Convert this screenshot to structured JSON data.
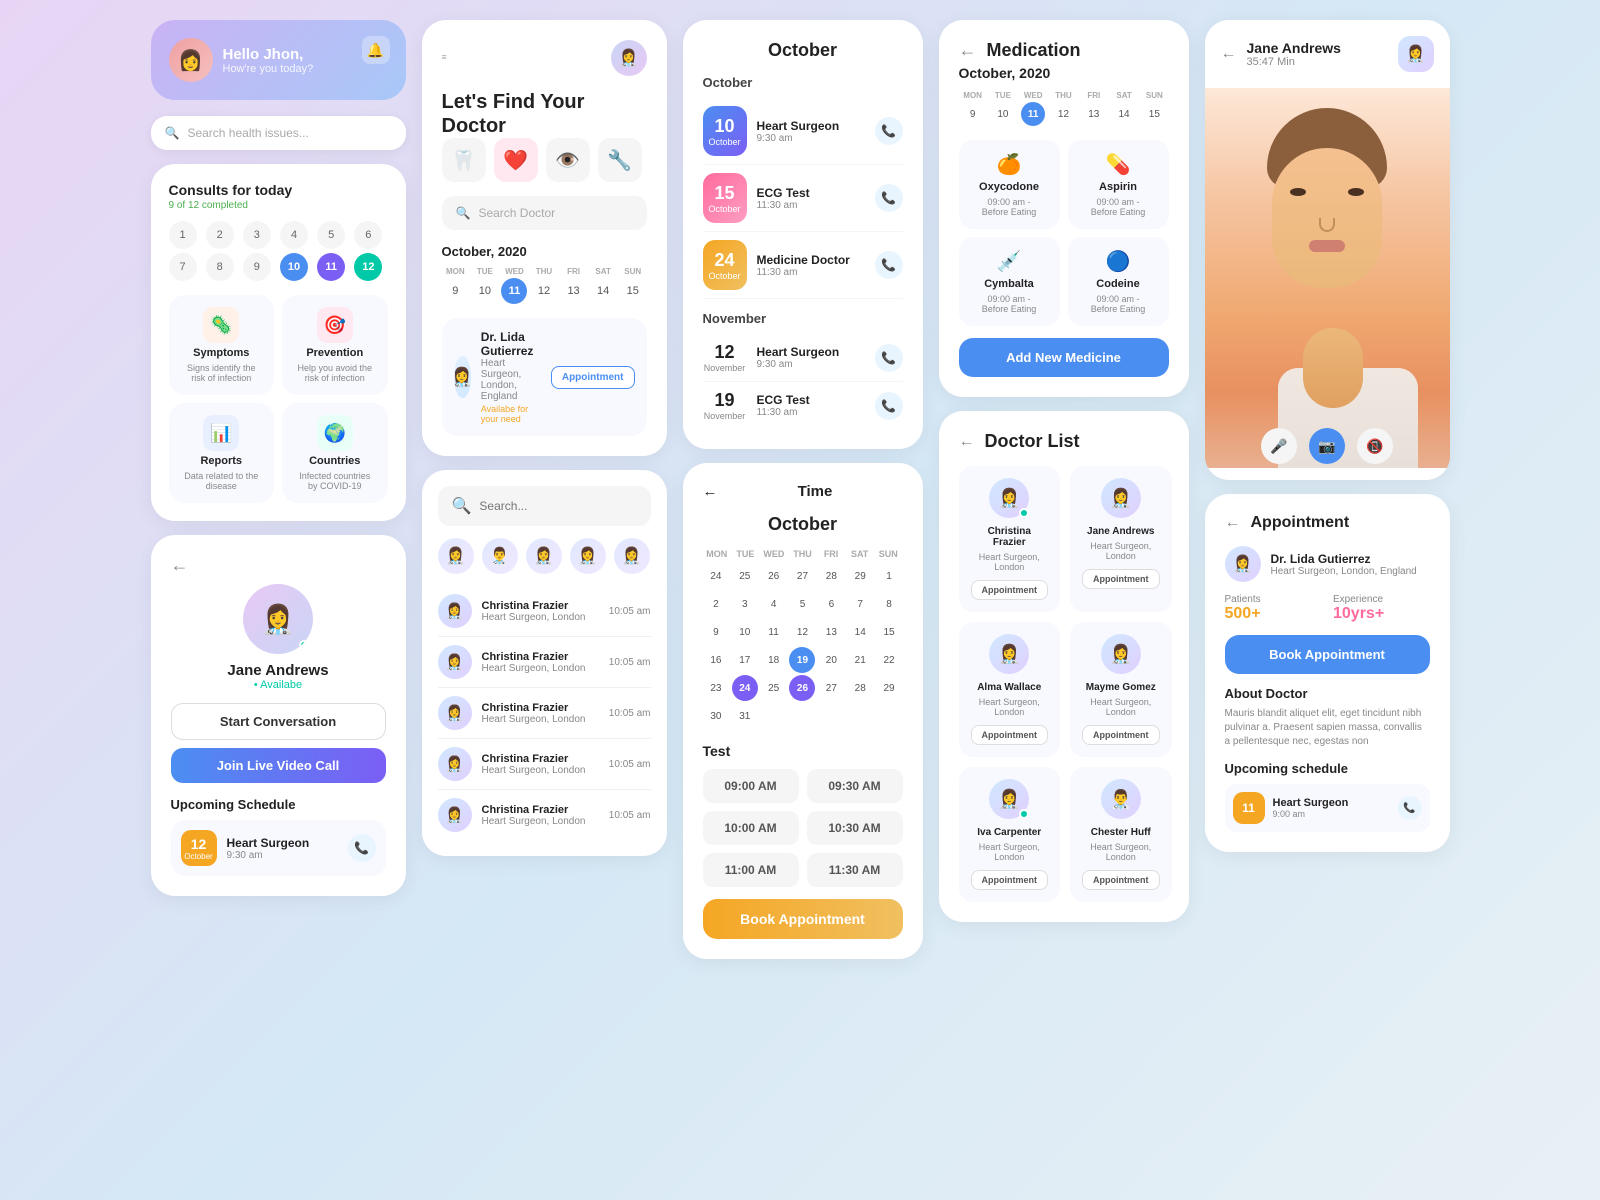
{
  "col1": {
    "hello": {
      "name": "Hello Jhon,",
      "subtitle": "How're you today?"
    },
    "search": {
      "placeholder": "Search health issues..."
    },
    "consults": {
      "title": "Consults for today",
      "sub": "9 of 12 completed",
      "dates": [
        "1",
        "2",
        "3",
        "4",
        "5",
        "6",
        "7",
        "8",
        "9",
        "10",
        "11",
        "12"
      ],
      "active_dates": [
        "10",
        "11",
        "12"
      ]
    },
    "health_items": [
      {
        "icon": "🦠",
        "title": "Symptoms",
        "desc": "Signs identify the risk of infection"
      },
      {
        "icon": "🎯",
        "title": "Prevention",
        "desc": "Help you avoid the risk of infection"
      },
      {
        "icon": "📊",
        "title": "Reports",
        "desc": "Data related to the disease"
      },
      {
        "icon": "🌍",
        "title": "Countries",
        "desc": "Infected countries by COVID-19"
      }
    ],
    "profile": {
      "name": "Jane Andrews",
      "status": "• Availabe",
      "start_btn": "Start Conversation",
      "join_btn": "Join Live Video Call"
    },
    "upcoming": {
      "title": "Upcoming Schedule",
      "date": "12",
      "month": "October",
      "type": "Heart Surgeon",
      "time": "9:30 am"
    }
  },
  "col2": {
    "find_doctor": {
      "title1": "Let's Find Your",
      "title2": "Doctor"
    },
    "date_section": {
      "title": "October, 2020",
      "days": [
        "MON",
        "TUE",
        "WED",
        "THU",
        "FRI",
        "SAT",
        "SUN"
      ],
      "nums": [
        "9",
        "10",
        "11",
        "12",
        "13",
        "14",
        "15"
      ],
      "active": "11"
    },
    "doctor": {
      "name": "Dr. Lida Gutierrez",
      "specialty": "Heart Surgeon, London, England",
      "status": "Availabe for your need",
      "btn": "Appointment"
    },
    "search_placeholder": "Search...",
    "doctors_list": [
      {
        "name": "Christina Frazier",
        "specialty": "Heart Surgeon, London",
        "time": "10:05 am"
      },
      {
        "name": "Christina Frazier",
        "specialty": "Heart Surgeon, London",
        "time": "10:05 am"
      },
      {
        "name": "Christina Frazier",
        "specialty": "Heart Surgeon, London",
        "time": "10:05 am"
      },
      {
        "name": "Christina Frazier",
        "specialty": "Heart Surgeon, London",
        "time": "10:05 am"
      },
      {
        "name": "Christina Frazier",
        "specialty": "Heart Surgeon, London",
        "time": "10:05 am"
      }
    ]
  },
  "col3": {
    "schedule": {
      "title": "October",
      "months": [
        {
          "month": "October",
          "items": [
            {
              "date": "10",
              "month": "October",
              "type": "Heart Surgeon",
              "time": "9:30 am",
              "color": "blue"
            },
            {
              "date": "15",
              "month": "October",
              "type": "ECG Test",
              "time": "11:30 am",
              "color": "pink"
            },
            {
              "date": "24",
              "month": "October",
              "type": "Medicine Doctor",
              "time": "11:30 am",
              "color": "orange"
            }
          ]
        },
        {
          "month": "November",
          "items": [
            {
              "date": "12",
              "month": "November",
              "type": "Heart Surgeon",
              "time": "9:30 am",
              "color": "gray"
            },
            {
              "date": "19",
              "month": "November",
              "type": "ECG Test",
              "time": "11:30 am",
              "color": "gray"
            }
          ]
        }
      ]
    },
    "time": {
      "header": "Time",
      "month": "October",
      "days": [
        "MON",
        "TUE",
        "WED",
        "THU",
        "FRI",
        "SAT",
        "SUN"
      ],
      "weeks": [
        [
          "24",
          "25",
          "26",
          "27",
          "28",
          "29",
          "1"
        ],
        [
          "2",
          "3",
          "4",
          "5",
          "6",
          "7",
          "8"
        ],
        [
          "9",
          "10",
          "11",
          "12",
          "13",
          "14",
          "15"
        ],
        [
          "16",
          "17",
          "18",
          "19",
          "20",
          "21",
          "22"
        ],
        [
          "23",
          "24",
          "25",
          "26",
          "27",
          "28",
          "29"
        ],
        [
          "30",
          "31",
          "",
          "",
          "",
          "",
          ""
        ]
      ],
      "today": "19",
      "test": "Test",
      "slots": [
        "09:00 AM",
        "09:30 AM",
        "10:00 AM",
        "10:30 AM",
        "11:00 AM",
        "11:30 AM"
      ],
      "book_btn": "Book Appointment"
    }
  },
  "col4": {
    "medication": {
      "title": "Medication",
      "date": "October, 2020",
      "days": [
        "MON",
        "TUE",
        "WED",
        "THU",
        "FRI",
        "SAT",
        "SUN"
      ],
      "nums": [
        "9",
        "10",
        "11",
        "12",
        "13",
        "14",
        "15"
      ],
      "active": "11",
      "medicines": [
        {
          "icon": "🍊",
          "name": "Oxycodone",
          "time": "09:00 am -",
          "note": "Before Eating"
        },
        {
          "icon": "💊",
          "name": "Aspirin",
          "time": "09:00 am -",
          "note": "Before Eating"
        },
        {
          "icon": "💉",
          "name": "Cymbalta",
          "time": "09:00 am -",
          "note": "Before Eating"
        },
        {
          "icon": "🔵",
          "name": "Codeine",
          "time": "09:00 am -",
          "note": "Before Eating"
        }
      ],
      "add_btn": "Add New Medicine"
    },
    "doctor_list": {
      "title": "Doctor List",
      "doctors": [
        {
          "name": "Christina Frazier",
          "specialty": "Heart Surgeon, London",
          "online": true
        },
        {
          "name": "Jane Andrews",
          "specialty": "Heart Surgeon, London",
          "online": false
        },
        {
          "name": "Alma Wallace",
          "specialty": "Heart Surgeon, London",
          "online": false
        },
        {
          "name": "Mayme Gomez",
          "specialty": "Heart Surgeon, London",
          "online": false
        },
        {
          "name": "Iva Carpenter",
          "specialty": "Heart Surgeon, London",
          "online": true
        },
        {
          "name": "Chester Huff",
          "specialty": "Heart Surgeon, London",
          "online": false
        }
      ],
      "appt_btn": "Appointment"
    }
  },
  "col5": {
    "video": {
      "name": "Jane Andrews",
      "time": "35:47 Min"
    },
    "appointment": {
      "title": "Appointment",
      "doc_name": "Dr. Lida Gutierrez",
      "doc_specialty": "Heart Surgeon, London, England",
      "patients_label": "Patients",
      "patients_value": "500+",
      "experience_label": "Experience",
      "experience_value": "10yrs+",
      "book_btn": "Book Appointment",
      "about_title": "About Doctor",
      "about_text": "Mauris blandit aliquet elit, eget tincidunt nibh pulvinar a. Praesent sapien massa, convallis a pellentesque nec, egestas non",
      "upcoming_title": "Upcoming schedule",
      "upcoming_type": "Heart Surgeon",
      "upcoming_time": "9:00 am",
      "upcoming_date": "11"
    }
  }
}
